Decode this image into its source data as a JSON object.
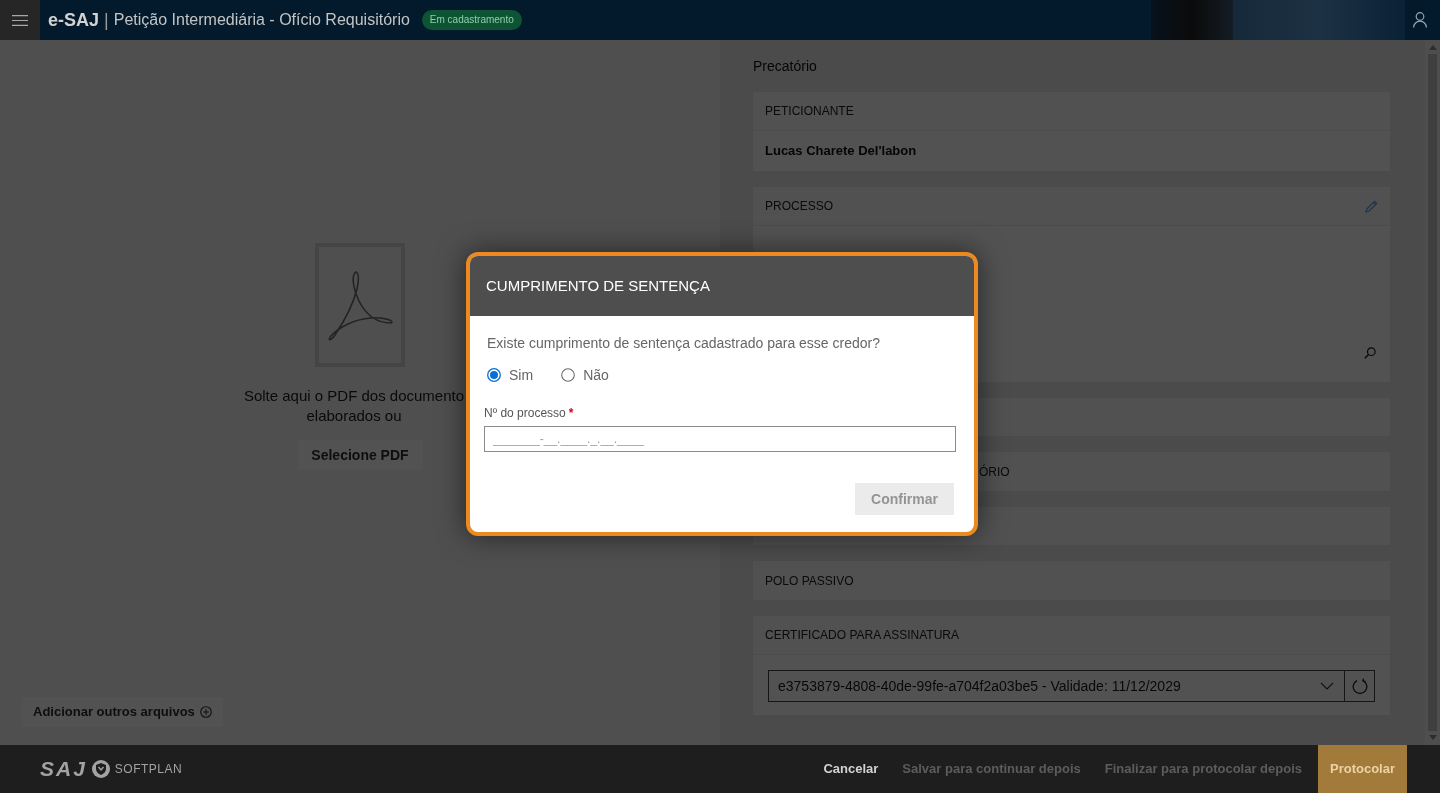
{
  "header": {
    "brand": "e-SAJ",
    "separator": "|",
    "title": "Petição Intermediária - Ofício Requisitório",
    "status_badge": "Em cadastramento"
  },
  "upload_panel": {
    "drop_text": [
      "Solte aqui o PDF dos documento",
      "elaborados ou"
    ],
    "select_button": "Selecione PDF",
    "add_files_button": "Adicionar outros arquivos"
  },
  "form": {
    "title": "Precatório",
    "sections": [
      {
        "kind": "value",
        "header": "PETICIONANTE",
        "value": "Lucas Charete Del'labon"
      },
      {
        "kind": "search_panel",
        "header": "PROCESSO"
      },
      {
        "kind": "blank"
      },
      {
        "kind": "covered_header",
        "header": "ÓRIO"
      },
      {
        "kind": "blank"
      },
      {
        "kind": "header",
        "header": "POLO PASSIVO"
      },
      {
        "kind": "select",
        "header": "CERTIFICADO PARA ASSINATURA",
        "value": "e3753879-4808-40de-99fe-a704f2a03be5 - Validade: 11/12/2029"
      }
    ]
  },
  "dialog": {
    "title": "CUMPRIMENTO DE SENTENÇA",
    "question": "Existe cumprimento de sentença cadastrado para esse credor?",
    "options": [
      {
        "label": "Sim",
        "selected": true
      },
      {
        "label": "Não",
        "selected": false
      }
    ],
    "field": {
      "label": "Nº do processo",
      "required_marker": "*",
      "placeholder": "_______-__.____._.__.____"
    },
    "confirm_button": {
      "label": "Confirmar",
      "disabled": true
    }
  },
  "footer": {
    "logo": "SAJ",
    "brand": "SOFTPLAN",
    "actions": [
      {
        "kind": "link",
        "label": "Cancelar",
        "disabled": false
      },
      {
        "kind": "link",
        "label": "Salvar para continuar depois",
        "disabled": true
      },
      {
        "kind": "link",
        "label": "Finalizar para protocolar depois",
        "disabled": true
      },
      {
        "kind": "primary",
        "label": "Protocolar",
        "disabled": true
      }
    ]
  }
}
